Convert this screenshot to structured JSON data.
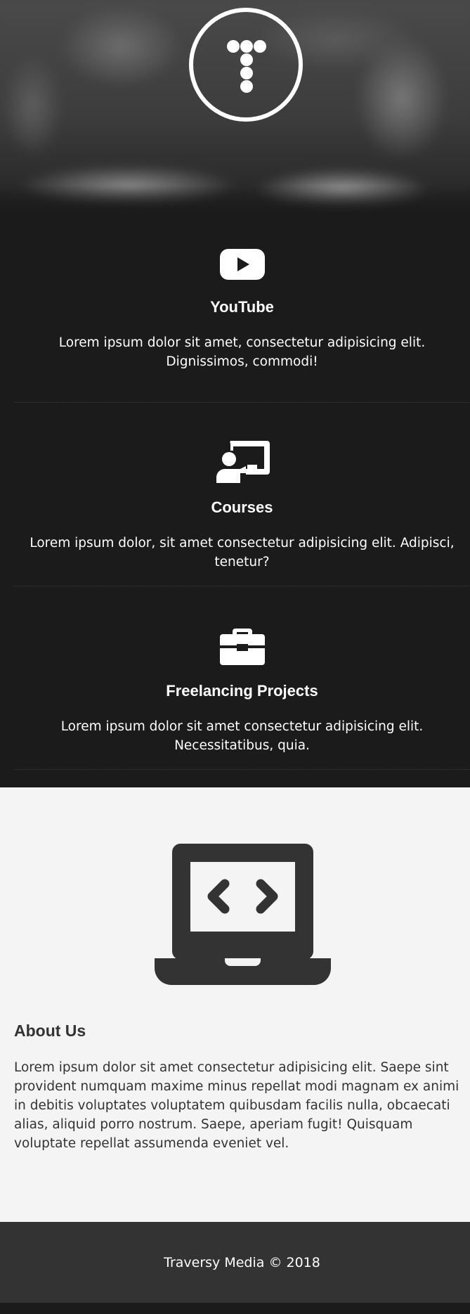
{
  "hero": {
    "logo_icon": "traversy-t-dots-logo"
  },
  "services": [
    {
      "icon": "youtube-icon",
      "title": "YouTube",
      "text": "Lorem ipsum dolor sit amet, consectetur adipisicing elit. Dignissimos, commodi!"
    },
    {
      "icon": "chalkboard-teacher-icon",
      "title": "Courses",
      "text": "Lorem ipsum dolor, sit amet consectetur adipisicing elit. Adipisci, tenetur?"
    },
    {
      "icon": "briefcase-icon",
      "title": "Freelancing Projects",
      "text": "Lorem ipsum dolor sit amet consectetur adipisicing elit. Necessitatibus, quia."
    }
  ],
  "about": {
    "icon": "laptop-code-icon",
    "title": "About Us",
    "text": "Lorem ipsum dolor sit amet consectetur adipisicing elit. Saepe sint provident numquam maxime minus repellat modi magnam ex animi in debitis voluptates voluptatem quibusdam facilis nulla, obcaecati alias, aliquid porro nostrum. Saepe, aperiam fugit! Quisquam voluptate repellat assumenda eveniet vel."
  },
  "footer": {
    "text": "Traversy Media © 2018"
  },
  "colors": {
    "dark_bg": "#1b1b1b",
    "light_bg": "#f4f4f4",
    "footer_bg": "#333333",
    "text_dark": "#333333",
    "text_light": "#ffffff"
  }
}
